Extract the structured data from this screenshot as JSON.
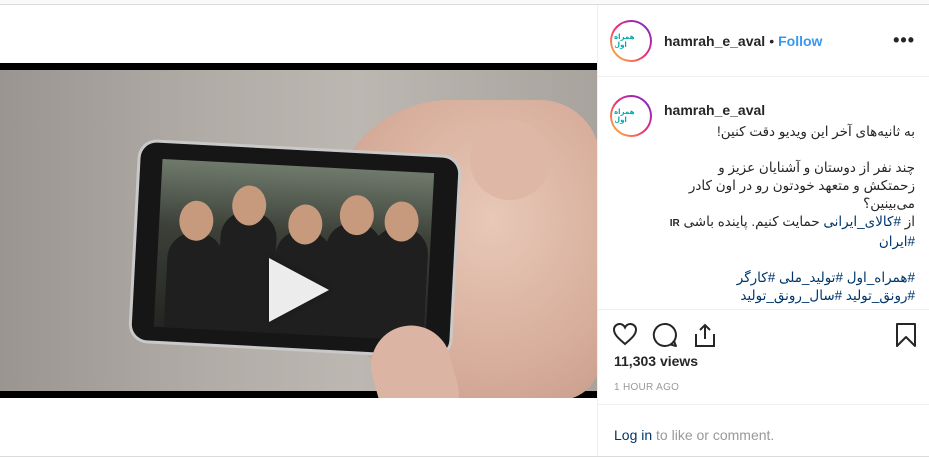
{
  "post": {
    "username": "hamrah_e_aval",
    "follow_label": "Follow",
    "separator": "•",
    "more_label": "•••",
    "logo_text": "همراه اول"
  },
  "caption": {
    "username": "hamrah_e_aval",
    "line1": "به ثانیه‌های آخر این ویدیو دقت کنین!",
    "line2": "چند نفر از دوستان و آشنایان عزیز و زحمتکش و متعهد خودتون رو در اون کادر می‌بینین؟",
    "line3_prefix": "از ",
    "line3_tag": "#کالای_ایرانی",
    "line3_suffix": " حمایت کنیم. پاینده باشی ",
    "line3_flag": "IR",
    "line3_tag2": "#ایران",
    "hashtags_line1": "#همراه_اول #تولید_ملی #کارگر",
    "hashtags_line2": "#رونق_تولید #سال_رونق_تولید"
  },
  "stats": {
    "views": "11,303 views",
    "time": "1 HOUR AGO"
  },
  "login": {
    "link": "Log in",
    "rest": " to like or comment."
  },
  "icons": {
    "like": "heart-icon",
    "comment": "comment-icon",
    "share": "share-icon",
    "save": "bookmark-icon",
    "play": "play-icon",
    "user_tag": "user-icon"
  }
}
